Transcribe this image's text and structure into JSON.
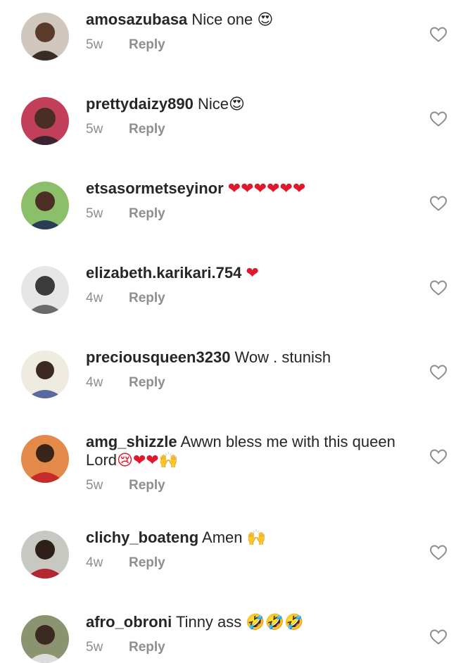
{
  "comments": [
    {
      "username": "amosazubasa",
      "text": " Nice one ",
      "emoji": "😍",
      "time": "5w",
      "reply": "Reply",
      "avatar_colors": [
        "#9a7c6a",
        "#3a2c26"
      ]
    },
    {
      "username": "prettydaizy890",
      "text": " Nice",
      "emoji": "😍",
      "time": "5w",
      "reply": "Reply",
      "avatar_colors": [
        "#c2405a",
        "#3b2430"
      ]
    },
    {
      "username": "etsasormetseyinor",
      "text": " ",
      "emoji": "❤❤❤❤❤❤",
      "time": "5w",
      "reply": "Reply",
      "avatar_colors": [
        "#6aa84f",
        "#2b3a55"
      ]
    },
    {
      "username": "elizabeth.karikari.754",
      "text": " ",
      "emoji": "❤",
      "time": "4w",
      "reply": "Reply",
      "avatar_colors": [
        "#d8d8d8",
        "#3b3b3b"
      ]
    },
    {
      "username": "preciousqueen3230",
      "text": " Wow . stunish",
      "emoji": "",
      "time": "4w",
      "reply": "Reply",
      "avatar_colors": [
        "#e8e0d0",
        "#5a6aa0"
      ]
    },
    {
      "username": "amg_shizzle",
      "text": " Awwn bless me with this queen",
      "text2": "Lord",
      "emoji": "😢❤❤🙌",
      "time": "5w",
      "reply": "Reply",
      "avatar_colors": [
        "#d96b3c",
        "#c62a2a"
      ]
    },
    {
      "username": "clichy_boateng",
      "text": " Amen ",
      "emoji": "🙌",
      "time": "4w",
      "reply": "Reply",
      "avatar_colors": [
        "#b6b6b0",
        "#b3262f"
      ]
    },
    {
      "username": "afro_obroni",
      "text": " Tinny ass ",
      "emoji": "🤣🤣🤣",
      "time": "5w",
      "reply": "Reply",
      "avatar_colors": [
        "#7f8a6a",
        "#cfcfcf"
      ]
    }
  ],
  "colors": {
    "username": "#262626",
    "meta": "#8e8e8e",
    "heart_outline": "#8e8e8e",
    "emoji_heart": "#e0182d",
    "emoji_face": "#f6c12b"
  },
  "icons": {
    "like": "heart-outline-icon"
  }
}
